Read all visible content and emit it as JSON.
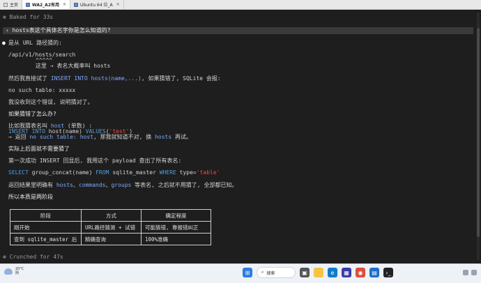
{
  "tabs": [
    {
      "label": "主页",
      "icon": "home-icon"
    },
    {
      "label": "WA2_A2有用",
      "icon": "vm-icon",
      "closable": true,
      "active": true
    },
    {
      "label": "Ubuntu 64 位_A",
      "icon": "vm-icon",
      "closable": true
    }
  ],
  "terminal": {
    "status_baked": "✻ Baked for 33s",
    "user_prompt": "› hosts表这个具体名字你是怎么知道的?",
    "answer_intro": "是从 URL 路径猜的:",
    "url_path": "/api/v1/hosts/search",
    "url_caret": "^^^^^",
    "url_note": "这里 → 表名大概率叫 hosts",
    "insert_try_pre": "然后我直接试了 ",
    "insert_try_code": "INSERT INTO hosts(name,...)",
    "insert_try_post": ", 如果猜错了, SQLite 会报:",
    "error_msg": "no such table: xxxxx",
    "no_error_note": "我没收到这个错误, 说明猜对了。",
    "if_wrong_heading": "如果猜错了怎么办?",
    "example_pre": "比如我猜表名叫 ",
    "example_code": "host",
    "example_post": " (单数) :",
    "sql_insert_kw1": "INSERT INTO",
    "sql_insert_mid": " host(name) ",
    "sql_insert_kw2": "VALUES",
    "sql_insert_paren_open": "(",
    "sql_insert_str": "'test'",
    "sql_insert_paren_close": ")",
    "return_pre": "→ 返回 ",
    "return_code": "no such table: host",
    "return_mid": ", 那我就知道不对, 换 ",
    "return_code2": "hosts",
    "return_post": " 再试。",
    "actual_heading": "实际上后面就不需要猜了",
    "first_insert_note": "第一次成功 INSERT 回显后, 我用这个 payload 查出了所有表名:",
    "sql_select_kw": "SELECT",
    "sql_select_mid1": " group_concat(name) ",
    "sql_select_from": "FROM",
    "sql_select_mid2": " sqlite_master ",
    "sql_select_where": "WHERE",
    "sql_select_mid3": " type=",
    "sql_select_str": "'table'",
    "result_pre": "返回结果里明确有 ",
    "result_t1": "hosts",
    "result_sep1": "、",
    "result_t2": "commands",
    "result_sep2": "、",
    "result_t3": "groups",
    "result_post": " 等表名, 之后就不用猜了, 全部都已知。",
    "two_stage": "所以本质是两阶段",
    "status_crunched": "✻ Crunched for 47s"
  },
  "table": {
    "headers": [
      "阶段",
      "方式",
      "确定程度"
    ],
    "rows": [
      [
        "刚开始",
        "URL路径猜测 + 试错",
        "可能猜错, 靠报错纠正"
      ],
      [
        "查到 sqlite_master 后",
        "精确查询",
        "100%准确"
      ]
    ]
  },
  "taskbar": {
    "temperature": "20°C",
    "weather_desc": "阴",
    "search_placeholder": "搜索"
  }
}
